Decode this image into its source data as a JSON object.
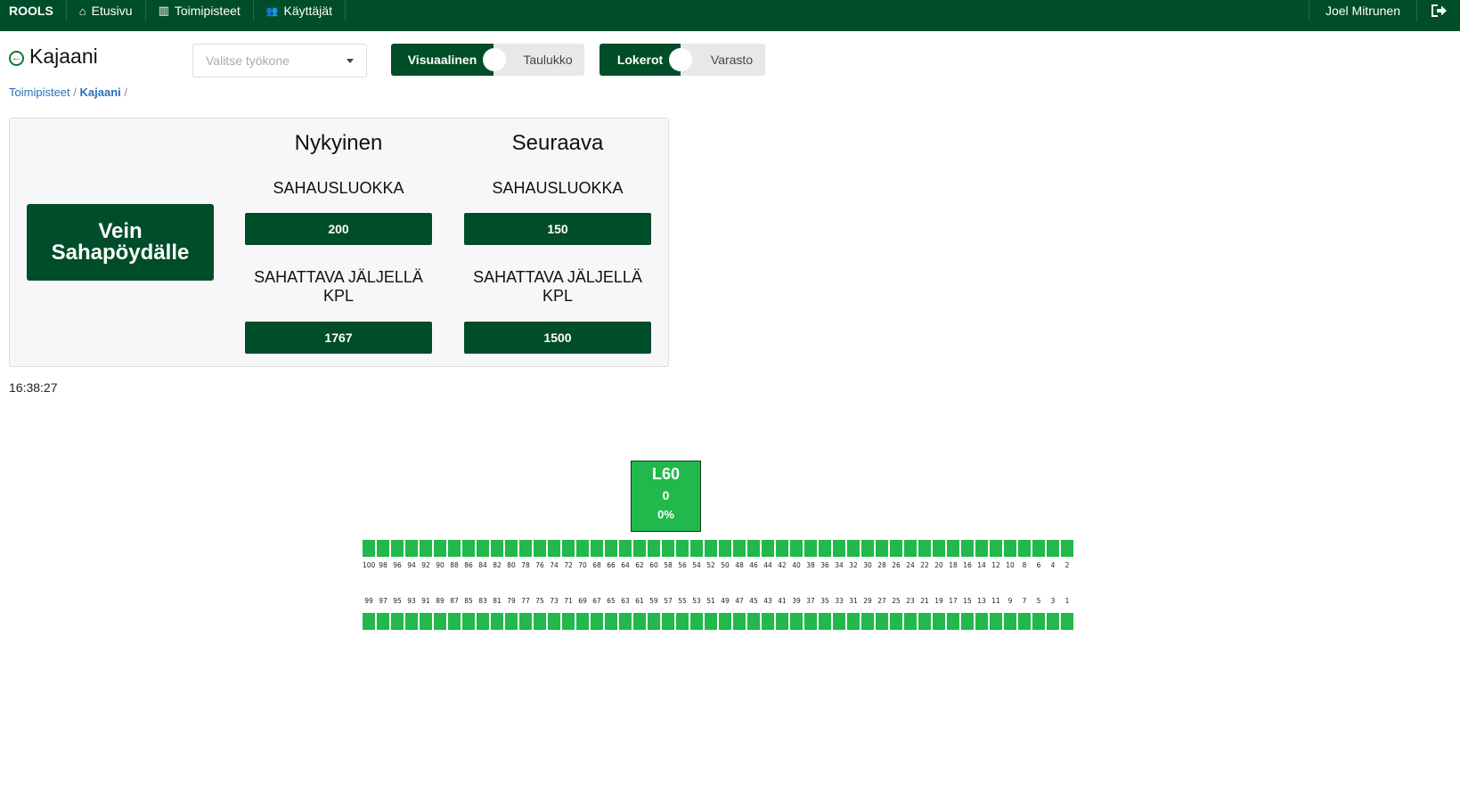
{
  "nav": {
    "brand": "ROOLS",
    "items": [
      {
        "label": "Etusivu",
        "icon": "home-icon",
        "glyph": "⌂"
      },
      {
        "label": "Toimipisteet",
        "icon": "map-icon",
        "glyph": "▥"
      },
      {
        "label": "Käyttäjät",
        "icon": "users-icon",
        "glyph": "👥"
      }
    ],
    "user": "Joel Mitrunen",
    "logout_icon": "logout-icon"
  },
  "header": {
    "title": "Kajaani",
    "back_icon": "back-arrow-icon",
    "select_placeholder": "Valitse työkone"
  },
  "toggles": {
    "view": {
      "on_label": "Visuaalinen",
      "off_label": "Taulukko"
    },
    "mode": {
      "on_label": "Lokerot",
      "off_label": "Varasto"
    }
  },
  "breadcrumb": {
    "items": [
      "Toimipisteet",
      "Kajaani"
    ]
  },
  "panel": {
    "action_button": "Vein Sahapöydälle",
    "current": {
      "heading": "Nykyinen",
      "class_label": "SAHAUSLUOKKA",
      "class_value": "200",
      "remaining_label": "SAHATTAVA JÄLJELLÄ KPL",
      "remaining_value": "1767"
    },
    "next": {
      "heading": "Seuraava",
      "class_label": "SAHAUSLUOKKA",
      "class_value": "150",
      "remaining_label": "SAHATTAVA JÄLJELLÄ KPL",
      "remaining_value": "1500"
    }
  },
  "clock": "16:38:27",
  "bin": {
    "name": "L60",
    "count": "0",
    "percent": "0%"
  },
  "slots": {
    "top_row": [
      "100",
      "98",
      "96",
      "94",
      "92",
      "90",
      "88",
      "86",
      "84",
      "82",
      "80",
      "78",
      "76",
      "74",
      "72",
      "70",
      "68",
      "66",
      "64",
      "62",
      "60",
      "58",
      "56",
      "54",
      "52",
      "50",
      "48",
      "46",
      "44",
      "42",
      "40",
      "38",
      "36",
      "34",
      "32",
      "30",
      "28",
      "26",
      "24",
      "22",
      "20",
      "18",
      "16",
      "14",
      "12",
      "10",
      "8",
      "6",
      "4",
      "2"
    ],
    "bottom_row": [
      "99",
      "97",
      "95",
      "93",
      "91",
      "89",
      "87",
      "85",
      "83",
      "81",
      "79",
      "77",
      "75",
      "73",
      "71",
      "69",
      "67",
      "65",
      "63",
      "61",
      "59",
      "57",
      "55",
      "53",
      "51",
      "49",
      "47",
      "45",
      "43",
      "41",
      "39",
      "37",
      "35",
      "33",
      "31",
      "29",
      "27",
      "25",
      "23",
      "21",
      "19",
      "17",
      "15",
      "13",
      "11",
      "9",
      "7",
      "5",
      "3",
      "1"
    ],
    "color": "#21b84c"
  },
  "colors": {
    "brand": "#004d2a",
    "slot": "#21b84c",
    "link": "#2a6fbd"
  }
}
